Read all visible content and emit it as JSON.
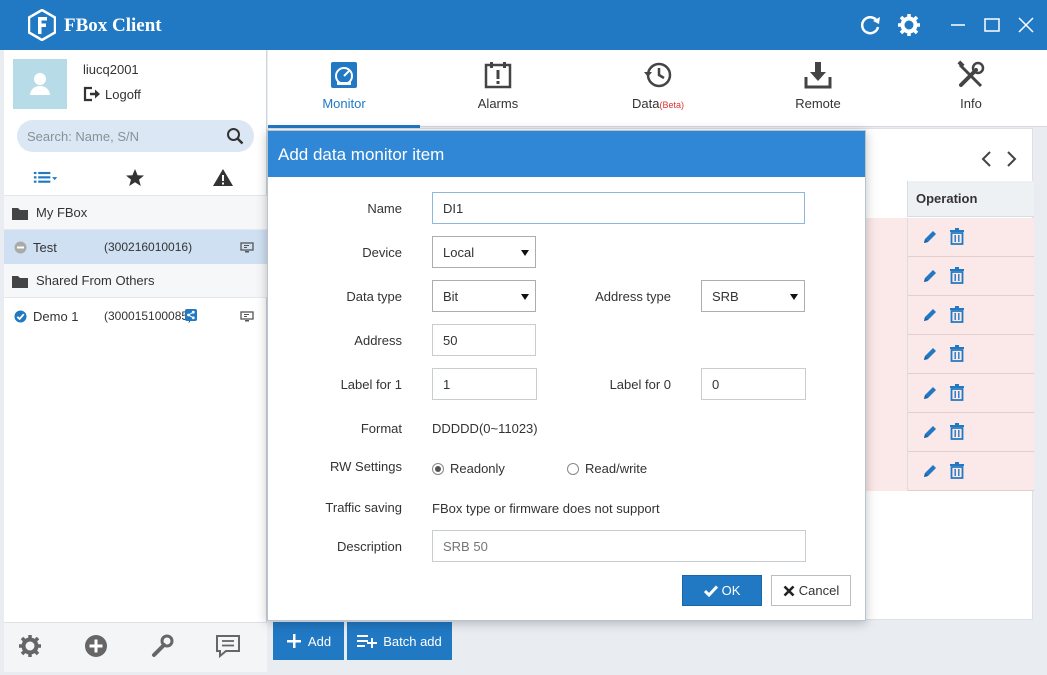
{
  "app": {
    "title": "FBox Client"
  },
  "user": {
    "name": "liucq2001",
    "logoff_label": "Logoff"
  },
  "search": {
    "placeholder": "Search: Name, S/N"
  },
  "sidebar": {
    "groups": [
      {
        "label": "My FBox"
      },
      {
        "label": "Shared From Others"
      }
    ],
    "boxes": [
      {
        "name": "Test",
        "sn": "(300216010016)",
        "status": "offline"
      },
      {
        "name": "Demo 1",
        "sn": "(300015100085)",
        "status": "online"
      }
    ]
  },
  "nav": {
    "tabs": [
      {
        "label": "Monitor",
        "icon": "monitor-icon",
        "active": true
      },
      {
        "label": "Alarms",
        "icon": "alarm-icon",
        "active": false
      },
      {
        "label": "Data",
        "badge": "(Beta)",
        "icon": "history-icon",
        "active": false
      },
      {
        "label": "Remote",
        "icon": "download-icon",
        "active": false
      },
      {
        "label": "Info",
        "icon": "tools-icon",
        "active": false
      }
    ]
  },
  "table": {
    "operation_header": "Operation",
    "row_count": 7
  },
  "actions": {
    "add_label": "Add",
    "batch_add_label": "Batch add"
  },
  "dialog": {
    "title": "Add data monitor item",
    "name_label": "Name",
    "name_value": "DI1",
    "device_label": "Device",
    "device_value": "Local",
    "data_type_label": "Data type",
    "data_type_value": "Bit",
    "address_type_label": "Address type",
    "address_type_value": "SRB",
    "address_label": "Address",
    "address_value": "50",
    "label1_label": "Label for 1",
    "label1_value": "1",
    "label0_label": "Label for 0",
    "label0_value": "0",
    "format_label": "Format",
    "format_value": "DDDDD(0~11023)",
    "rw_label": "RW Settings",
    "rw_readonly": "Readonly",
    "rw_readwrite": "Read/write",
    "rw_selected": "Readonly",
    "traffic_label": "Traffic saving",
    "traffic_value": "FBox type or firmware does not support",
    "description_label": "Description",
    "description_placeholder": "SRB 50",
    "ok_label": "OK",
    "cancel_label": "Cancel"
  },
  "colors": {
    "accent": "#2179c4",
    "dialog_header": "#2f87d6",
    "row_highlight": "#fbe8e8"
  }
}
